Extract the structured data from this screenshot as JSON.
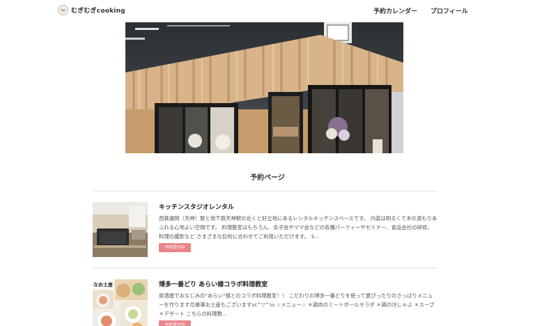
{
  "header": {
    "logo_text": "むぎむぎcooking",
    "nav": [
      {
        "label": "予約カレンダー"
      },
      {
        "label": "プロフィール"
      }
    ]
  },
  "page": {
    "section_title": "予約ページ"
  },
  "listings": [
    {
      "title": "キッチンスタジオレンタル",
      "description": "西鉄福岡（天神）駅と地下鉄天神駅の近くと好立地にあるレンタルキッチンスペースです。 内装は明るくて木の温もりあふれる心地よい空間です。 料理教室はもちろん、女子会やママ会などの各種パーティーやセミナー、食品会社の研修、料理の撮影など さまざまな目的に合わせてご利用いただけます。 3...",
      "badge": "予約受付中"
    },
    {
      "title": "博多一番どり あらい様コラボ料理教室",
      "description": "居酒屋でおなじみの\"あらい\"様とのコラボ料理教室！！ こだわりの博多一番どりを使って夏ぴったりのさっぱりメニューを作ります😊豪華お土産もございますo(^▽^)o ☆メニュー☆ ＊鶏肉のミートボールサラダ ＊鶏の冷しゃぶ ＊スープ ＊デザート こちらの料理教...",
      "badge": "予約受付中",
      "thumb_text": "なお土産"
    }
  ],
  "colors": {
    "badge": "#e9848a",
    "divider": "#e3e3e3",
    "text": "#333333"
  }
}
